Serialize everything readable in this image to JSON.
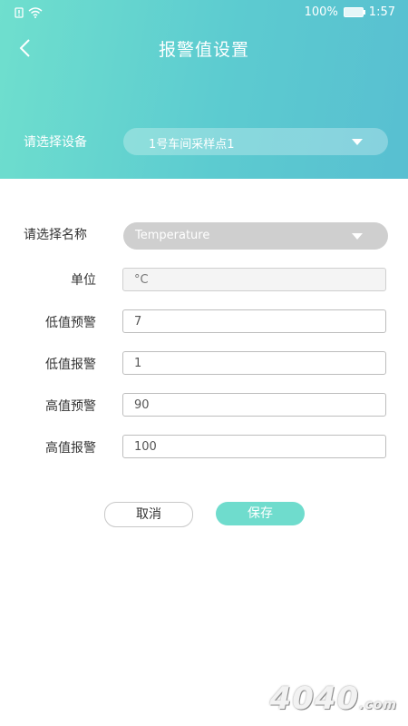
{
  "status_bar": {
    "battery": "100%",
    "time": "1:57"
  },
  "header": {
    "title": "报警值设置"
  },
  "device": {
    "label": "请选择设备",
    "selected": "1号车间采样点1"
  },
  "name": {
    "label": "请选择名称",
    "selected": "Temperature"
  },
  "fields": [
    {
      "label": "单位",
      "value": "°C"
    },
    {
      "label": "低值预警",
      "value": "7"
    },
    {
      "label": "低值报警",
      "value": "1"
    },
    {
      "label": "高值预警",
      "value": "90"
    },
    {
      "label": "高值报警",
      "value": "100"
    }
  ],
  "actions": {
    "cancel": "取消",
    "save": "保存"
  },
  "watermark": {
    "text": "4040",
    "suffix": ".com"
  },
  "colors": {
    "header_start": "#6fdfce",
    "header_end": "#58bfd1",
    "save_button": "#6fdccd"
  }
}
